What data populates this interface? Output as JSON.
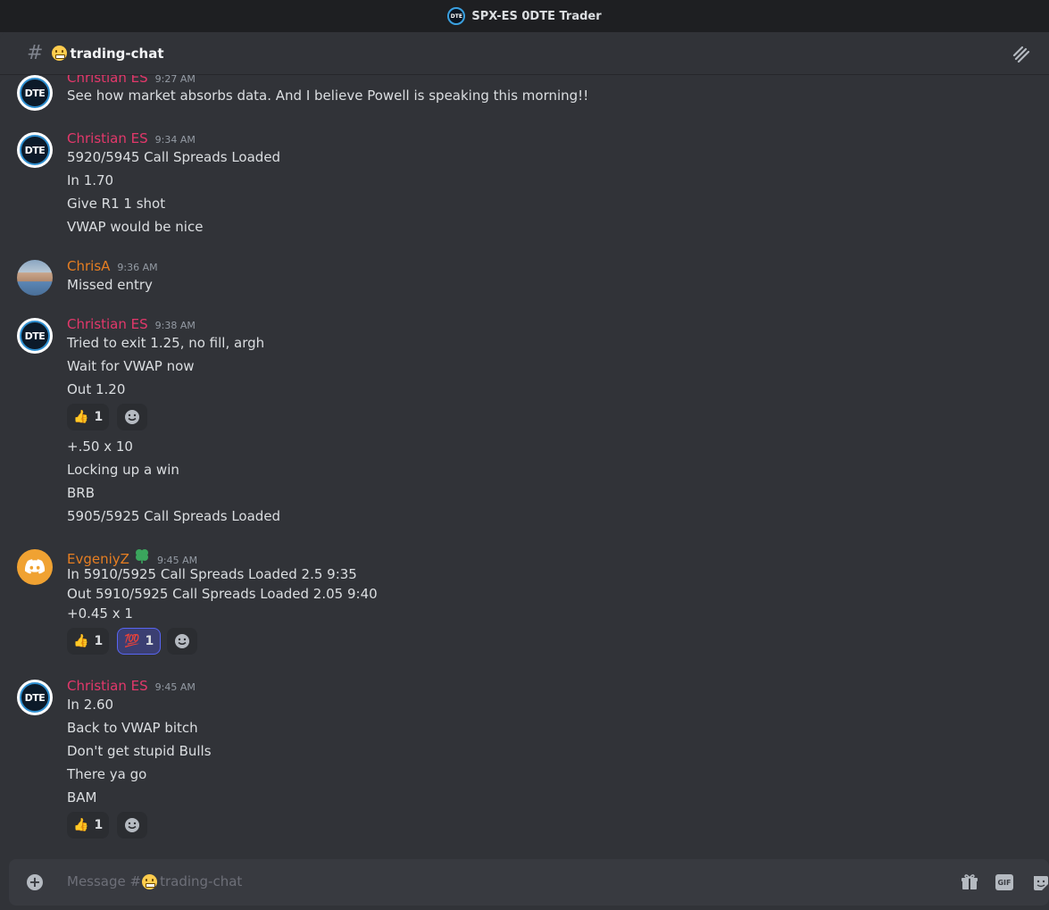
{
  "window": {
    "title": "SPX-ES 0DTE Trader",
    "logo_text": "DTE"
  },
  "channel": {
    "name": "trading-chat",
    "hash": "#"
  },
  "messages": [
    {
      "author": "Christian ES",
      "time": "9:27 AM",
      "lines": [
        "See how market absorbs data. And I believe Powell is speaking this morning!!"
      ]
    },
    {
      "author": "Christian ES",
      "time": "9:34 AM",
      "lines": [
        "5920/5945 Call Spreads Loaded",
        "In 1.70",
        "Give R1 1 shot",
        "VWAP would be nice"
      ]
    },
    {
      "author": "ChrisA",
      "time": "9:36 AM",
      "lines": [
        "Missed entry"
      ]
    },
    {
      "author": "Christian ES",
      "time": "9:38 AM",
      "lines": [
        "Tried to exit 1.25, no fill, argh",
        "Wait for VWAP now",
        "Out 1.20"
      ],
      "reactions": [
        {
          "emoji": "👍",
          "count": "1"
        }
      ],
      "lines_after": [
        "+.50 x 10",
        "Locking up a win",
        "BRB",
        "5905/5925 Call Spreads Loaded"
      ]
    },
    {
      "author": "EvgeniyZ",
      "time": "9:45 AM",
      "lines": [
        "In 5910/5925 Call Spreads Loaded 2.5  9:35",
        "Out 5910/5925 Call Spreads Loaded 2.05  9:40",
        "+0.45 x 1"
      ],
      "reactions": [
        {
          "emoji": "👍",
          "count": "1"
        },
        {
          "emoji": "💯",
          "count": "1"
        }
      ]
    },
    {
      "author": "Christian ES",
      "time": "9:45 AM",
      "lines": [
        "In 2.60",
        "Back to VWAP bitch",
        "Don't get stupid Bulls",
        "There ya go",
        "BAM"
      ],
      "reactions": [
        {
          "emoji": "👍",
          "count": "1"
        }
      ]
    }
  ],
  "composer": {
    "placeholder_prefix": "Message #",
    "placeholder_channel": "trading-chat",
    "gif_label": "GIF"
  },
  "colors": {
    "background": "#313338",
    "author_red": "#e3386b",
    "author_orange": "#e67e22",
    "accent": "#5865f2"
  }
}
